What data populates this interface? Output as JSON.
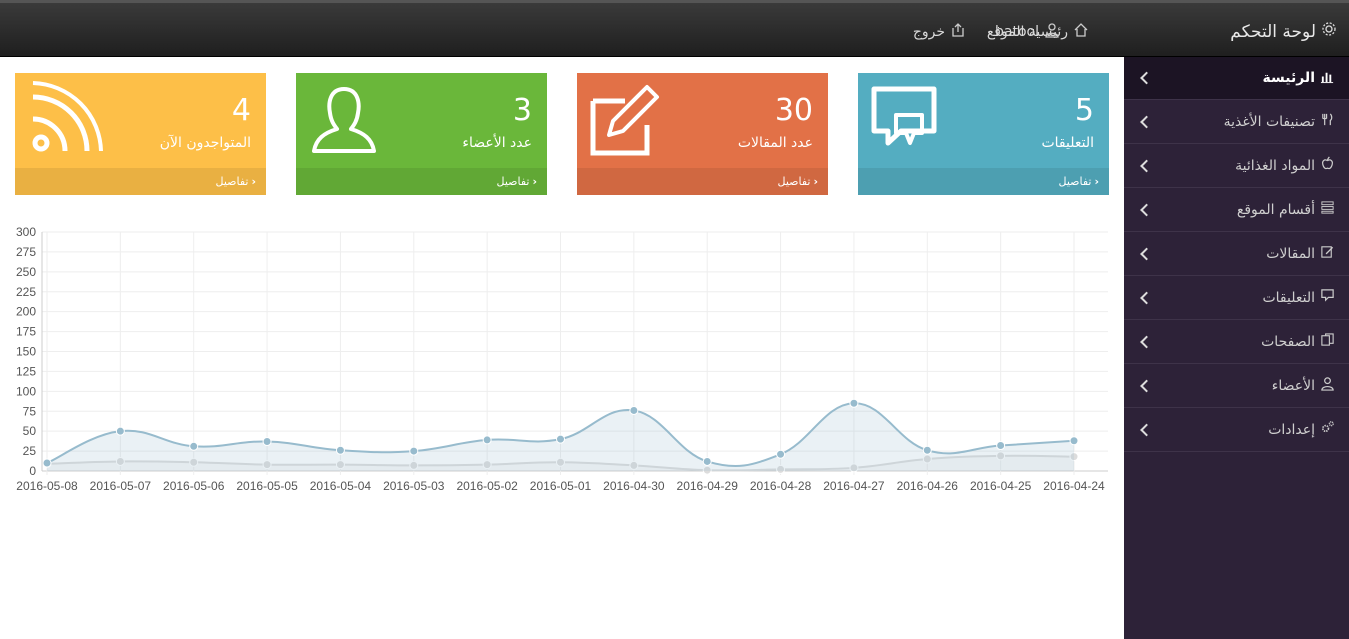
{
  "topbar": {
    "brand": "لوحة التحكم",
    "site_home": "رئيسية الموقع",
    "user": "batool",
    "logout": "خروج"
  },
  "sidebar": {
    "items": [
      {
        "label": "الرئيسة",
        "icon": "bar-chart-icon",
        "active": true
      },
      {
        "label": "تصنيفات الأغذية",
        "icon": "cutlery-icon"
      },
      {
        "label": "المواد الغذائية",
        "icon": "apple-icon"
      },
      {
        "label": "أقسام الموقع",
        "icon": "list-icon"
      },
      {
        "label": "المقالات",
        "icon": "edit-icon"
      },
      {
        "label": "التعليقات",
        "icon": "comment-icon"
      },
      {
        "label": "الصفحات",
        "icon": "files-icon"
      },
      {
        "label": "الأعضاء",
        "icon": "user-icon"
      },
      {
        "label": "إعدادات",
        "icon": "gears-icon"
      }
    ]
  },
  "cards": [
    {
      "count": "5",
      "label": "التعليقات",
      "details": "تفاصيل",
      "color": "#54adc1",
      "icon": "comments-icon"
    },
    {
      "count": "30",
      "label": "عدد المقالات",
      "details": "تفاصيل",
      "color": "#e27147",
      "icon": "pencil-square-icon"
    },
    {
      "count": "3",
      "label": "عدد الأعضاء",
      "details": "تفاصيل",
      "color": "#6ab73a",
      "icon": "user-icon"
    },
    {
      "count": "4",
      "label": "المتواجدون الآن",
      "details": "تفاصيل",
      "color": "#fdbf48",
      "icon": "rss-icon"
    }
  ],
  "chart_data": {
    "type": "line",
    "categories": [
      "2016-05-08",
      "2016-05-07",
      "2016-05-06",
      "2016-05-05",
      "2016-05-04",
      "2016-05-03",
      "2016-05-02",
      "2016-05-01",
      "2016-04-30",
      "2016-04-29",
      "2016-04-28",
      "2016-04-27",
      "2016-04-26",
      "2016-04-25",
      "2016-04-24"
    ],
    "series": [
      {
        "values": [
          10,
          50,
          31,
          37,
          26,
          25,
          39,
          40,
          76,
          12,
          21,
          85,
          26,
          32,
          38
        ],
        "color": "#97bbcd"
      },
      {
        "values": [
          9,
          12,
          11,
          8,
          8,
          7,
          8,
          11,
          7,
          1,
          2,
          4,
          15,
          19,
          18
        ],
        "color": "#dcdcdc"
      }
    ],
    "ylim": [
      0,
      300
    ],
    "yticks": [
      0,
      25,
      50,
      75,
      100,
      125,
      150,
      175,
      200,
      225,
      250,
      275,
      300
    ],
    "grid": true
  }
}
